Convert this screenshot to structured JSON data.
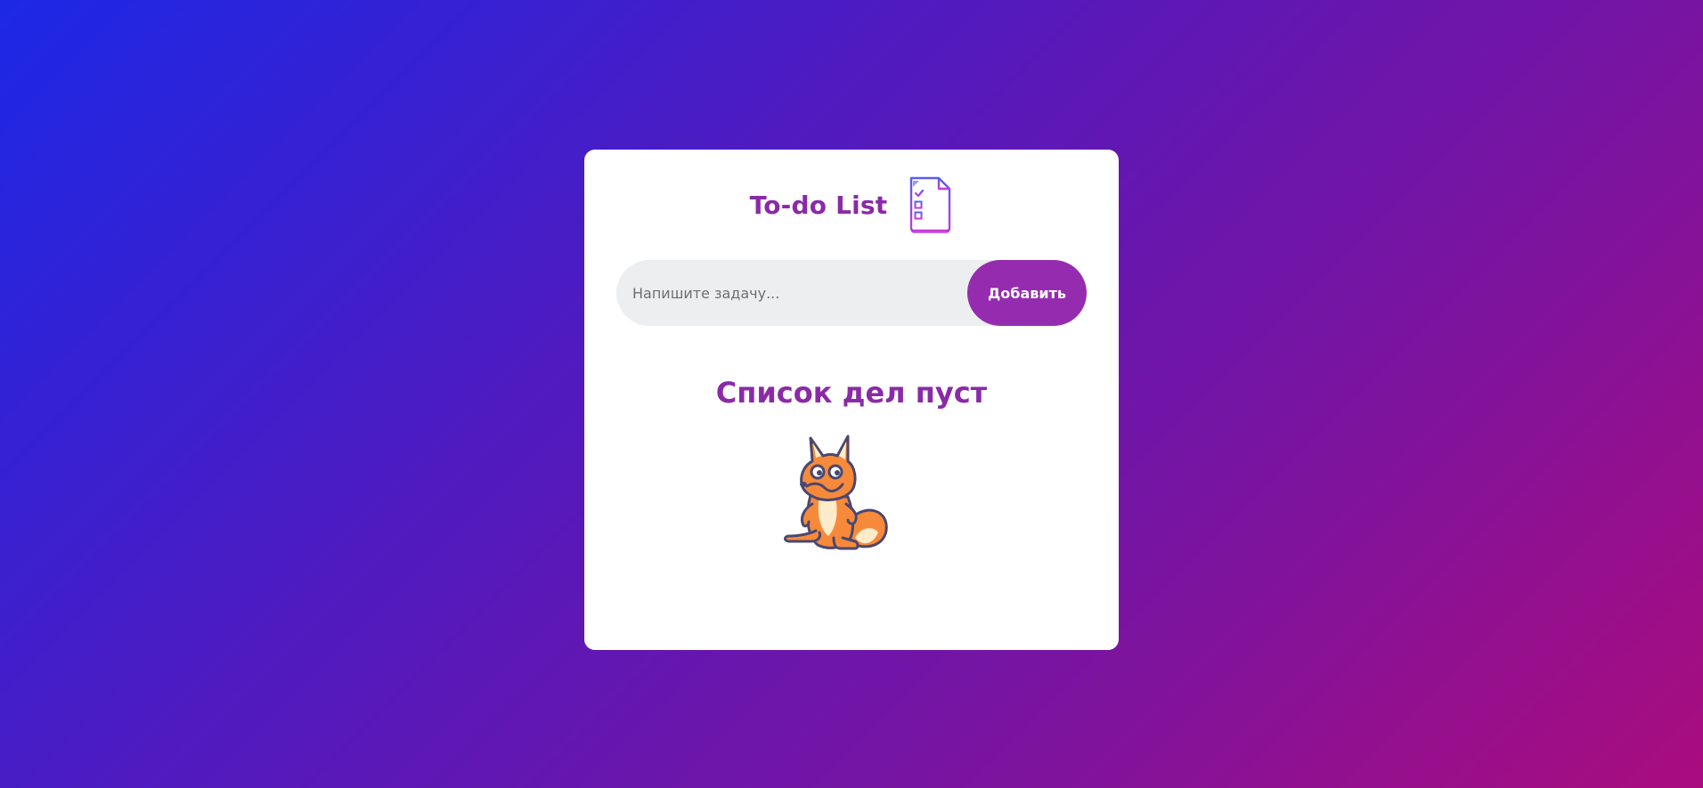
{
  "app": {
    "title": "To-do List",
    "logo_icon": "checklist-document-icon"
  },
  "form": {
    "input_placeholder": "Напишите задачу...",
    "input_value": "",
    "add_button_label": "Добавить"
  },
  "empty_state": {
    "message": "Список дел пуст",
    "illustration": "fox-illustration"
  },
  "colors": {
    "accent": "#952cb0",
    "title": "#8a2aa8",
    "background_start": "#1c28e6",
    "background_end": "#aa0c7e",
    "card": "#ffffff",
    "input_bg": "#edeef0"
  }
}
